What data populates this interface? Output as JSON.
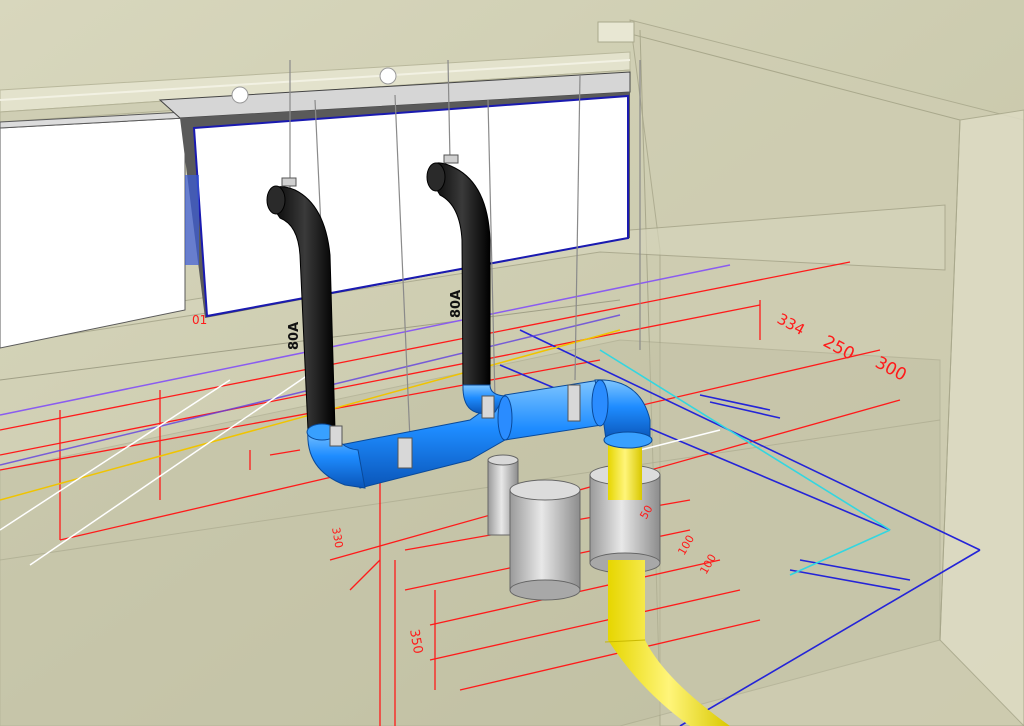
{
  "pipe_labels": [
    "80A",
    "80A"
  ],
  "dimensions": {
    "right_top": [
      "334",
      "250",
      "300"
    ],
    "center_small": [
      "50",
      "100",
      "100"
    ],
    "left_vertical": [
      "330",
      "350"
    ],
    "left_edge": "01"
  },
  "colors": {
    "drain_pipe_black": "#111111",
    "drain_pipe_blue": "#1e90ff",
    "drain_pipe_yellow": "#f2e400",
    "dimension_red": "#ff1a1a",
    "grid_blue": "#2424d8",
    "grid_purple": "#8a5cf0",
    "grid_yellow": "#f0c400",
    "grid_cyan": "#33d6e0",
    "wall": "#d4d2b8"
  }
}
